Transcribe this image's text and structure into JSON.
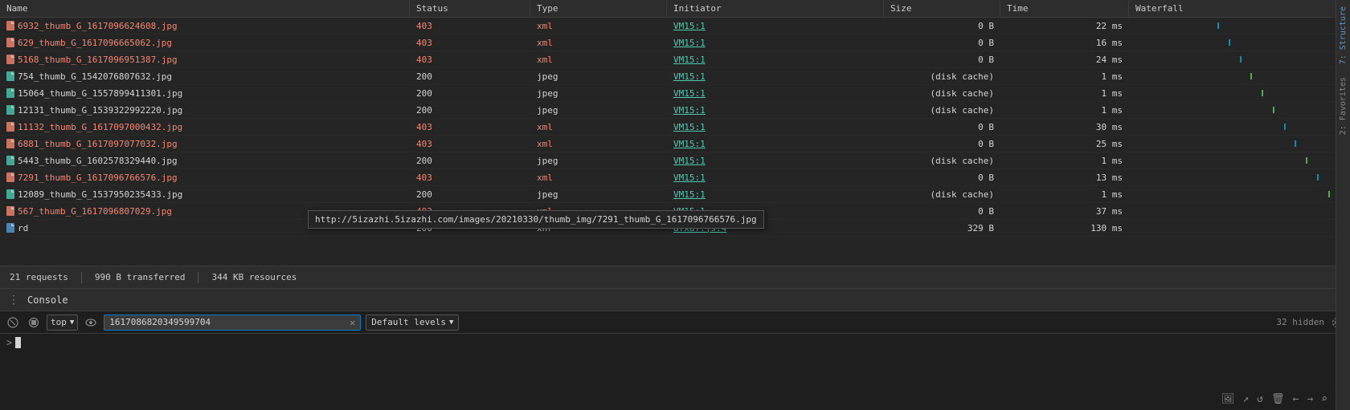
{
  "network": {
    "columns": [
      "Name",
      "Status",
      "Type",
      "Initiator",
      "Size",
      "Time",
      "Waterfall"
    ],
    "rows": [
      {
        "name": "6932_thumb_G_1617096624608.jpg",
        "status": "403",
        "type": "xml",
        "initiator": "VM15:1",
        "size": "0 B",
        "time": "22 ms",
        "isError": true,
        "hasBar": true
      },
      {
        "name": "629_thumb_G_1617096665062.jpg",
        "status": "403",
        "type": "xml",
        "initiator": "VM15:1",
        "size": "0 B",
        "time": "16 ms",
        "isError": true,
        "hasBar": true
      },
      {
        "name": "5168_thumb_G_1617096951387.jpg",
        "status": "403",
        "type": "xml",
        "initiator": "VM15:1",
        "size": "0 B",
        "time": "24 ms",
        "isError": true,
        "hasBar": true
      },
      {
        "name": "754_thumb_G_1542076807632.jpg",
        "status": "200",
        "type": "jpeg",
        "initiator": "VM15:1",
        "size": "(disk cache)",
        "time": "1 ms",
        "isError": false,
        "hasBar": true
      },
      {
        "name": "15064_thumb_G_1557899411301.jpg",
        "status": "200",
        "type": "jpeg",
        "initiator": "VM15:1",
        "size": "(disk cache)",
        "time": "1 ms",
        "isError": false,
        "hasBar": true
      },
      {
        "name": "12131_thumb_G_1539322992220.jpg",
        "status": "200",
        "type": "jpeg",
        "initiator": "VM15:1",
        "size": "(disk cache)",
        "time": "1 ms",
        "isError": false,
        "hasBar": true
      },
      {
        "name": "11132_thumb_G_1617097000432.jpg",
        "status": "403",
        "type": "xml",
        "initiator": "VM15:1",
        "size": "0 B",
        "time": "30 ms",
        "isError": true,
        "hasBar": true
      },
      {
        "name": "6881_thumb_G_1617097077032.jpg",
        "status": "403",
        "type": "xml",
        "initiator": "VM15:1",
        "size": "0 B",
        "time": "25 ms",
        "isError": true,
        "hasBar": true
      },
      {
        "name": "5443_thumb_G_1602578329440.jpg",
        "status": "200",
        "type": "jpeg",
        "initiator": "VM15:1",
        "size": "(disk cache)",
        "time": "1 ms",
        "isError": false,
        "hasBar": true
      },
      {
        "name": "7291_thumb_G_1617096766576.jpg",
        "status": "403",
        "type": "xml",
        "initiator": "VM15:1",
        "size": "0 B",
        "time": "13 ms",
        "isError": true,
        "hasBar": true
      },
      {
        "name": "12089_thumb_G_1537950235433.jpg",
        "status": "200",
        "type": "jpeg",
        "initiator": "VM15:1",
        "size": "(disk cache)",
        "time": "1 ms",
        "isError": false,
        "hasBar": true
      },
      {
        "name": "567_thumb_G_1617096807029.jpg",
        "status": "403",
        "type": "xml",
        "initiator": "VM15:1",
        "size": "0 B",
        "time": "37 ms",
        "isError": true,
        "hasBar": true
      },
      {
        "name": "rd",
        "status": "200",
        "type": "xhr",
        "initiator": "dfxaf.js:4",
        "size": "329 B",
        "time": "130 ms",
        "isError": false,
        "hasBar": true,
        "isXhr": true
      }
    ],
    "footer": {
      "requests": "21 requests",
      "transferred": "990 B transferred",
      "resources": "344 KB resources"
    },
    "tooltip": "http://5izazhi.5izazhi.com/images/20210330/thumb_img/7291_thumb_G_1617096766576.jpg"
  },
  "console": {
    "title": "Console",
    "context": "top",
    "input_value": "1617086820349599704",
    "levels_label": "Default levels",
    "hidden_count": "32 hidden",
    "close_label": "×"
  },
  "sidebar": {
    "tabs": [
      "7: Structure",
      "2: Favorites"
    ]
  },
  "bottom_icons": [
    "image-icon",
    "arrow-icon",
    "refresh-icon",
    "trash-icon",
    "arrow-left-icon",
    "arrow-right-icon",
    "search-icon"
  ]
}
